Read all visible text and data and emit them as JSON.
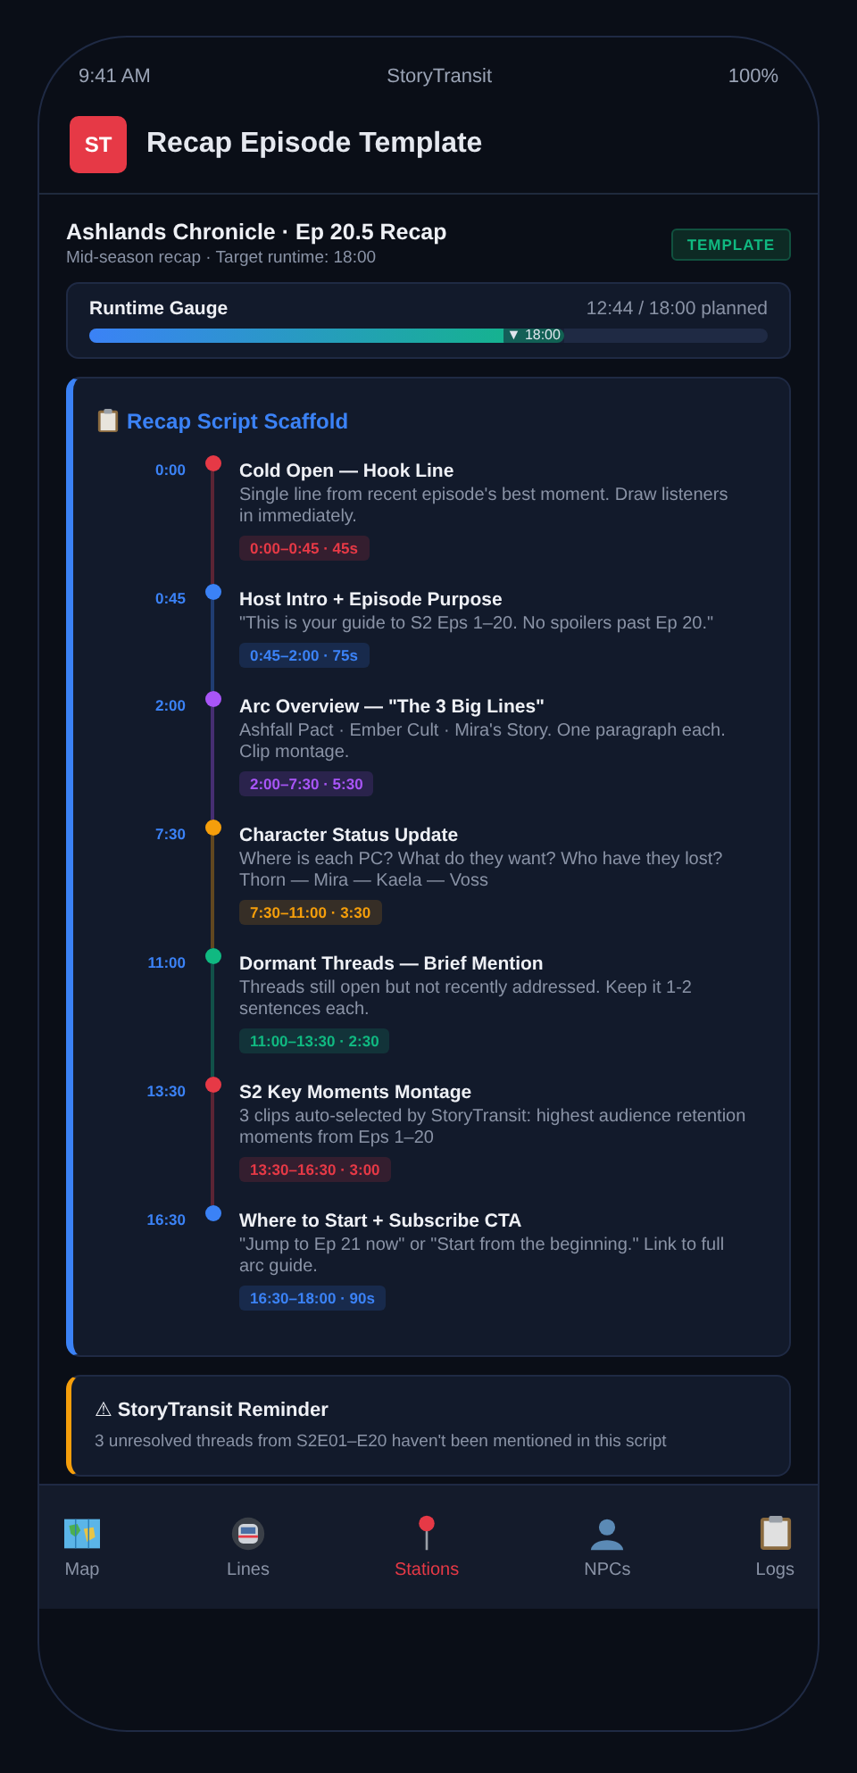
{
  "status_bar": {
    "time": "9:41 AM",
    "app_name": "StoryTransit",
    "battery": "100%"
  },
  "header": {
    "logo": "ST",
    "title": "Recap Episode Template"
  },
  "episode": {
    "title": "Ashlands Chronicle · Ep 20.5 Recap",
    "subtitle": "Mid-season recap · Target runtime: 18:00",
    "badge": "TEMPLATE"
  },
  "runtime_gauge": {
    "label": "Runtime Gauge",
    "reading": "12:44 / 18:00 planned",
    "level": 0.7,
    "marker": "▼ 18:00"
  },
  "scaffold": {
    "title": "Recap Script Scaffold",
    "segments": [
      {
        "time": "0:00",
        "title": "Cold Open — Hook Line",
        "description": "Single line from recent episode's best moment. Draw listeners in immediately.",
        "range": "0:00–0:45 · 45s",
        "color": "#e63946"
      },
      {
        "time": "0:45",
        "title": "Host Intro + Episode Purpose",
        "description": "\"This is your guide to S2 Eps 1–20. No spoilers past Ep 20.\"",
        "range": "0:45–2:00 · 75s",
        "color": "#3b82f6"
      },
      {
        "time": "2:00",
        "title": "Arc Overview — \"The 3 Big Lines\"",
        "description": "Ashfall Pact · Ember Cult · Mira's Story. One paragraph each. Clip montage.",
        "range": "2:00–7:30 · 5:30",
        "color": "#a855f7"
      },
      {
        "time": "7:30",
        "title": "Character Status Update",
        "description": "Where is each PC? What do they want? Who have they lost? Thorn — Mira — Kaela — Voss",
        "range": "7:30–11:00 · 3:30",
        "color": "#f59e0b"
      },
      {
        "time": "11:00",
        "title": "Dormant Threads — Brief Mention",
        "description": "Threads still open but not recently addressed. Keep it 1-2 sentences each.",
        "range": "11:00–13:30 · 2:30",
        "color": "#10b981"
      },
      {
        "time": "13:30",
        "title": "S2 Key Moments Montage",
        "description": "3 clips auto-selected by StoryTransit: highest audience retention moments from Eps 1–20",
        "range": "13:30–16:30 · 3:00",
        "color": "#e63946"
      },
      {
        "time": "16:30",
        "title": "Where to Start + Subscribe CTA",
        "description": "\"Jump to Ep 21 now\" or \"Start from the beginning.\" Link to full arc guide.",
        "range": "16:30–18:00 · 90s",
        "color": "#3b82f6"
      }
    ]
  },
  "reminder": {
    "title": "⚠ StoryTransit Reminder",
    "text": "3 unresolved threads from S2E01–E20 haven't been mentioned in this script"
  },
  "nav": [
    {
      "label": "Map",
      "kind": "map",
      "selected": false
    },
    {
      "label": "Lines",
      "kind": "train",
      "selected": false
    },
    {
      "label": "Stations",
      "kind": "pin",
      "selected": true
    },
    {
      "label": "NPCs",
      "kind": "person",
      "selected": false
    },
    {
      "label": "Logs",
      "kind": "clipboard",
      "selected": false
    }
  ]
}
